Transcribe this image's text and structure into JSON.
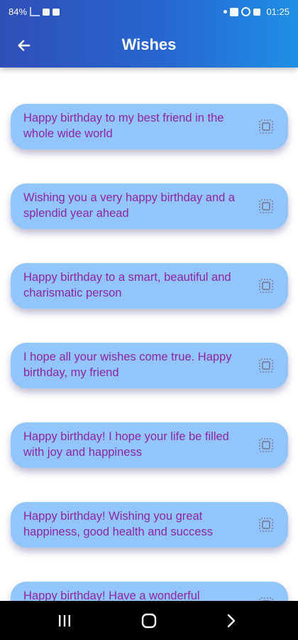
{
  "status_bar": {
    "battery": "84%",
    "time": "01:25"
  },
  "app_bar": {
    "title": "Wishes",
    "back_icon": "arrow-left-icon"
  },
  "wishes": [
    {
      "text": "Happy birthday to my best friend in the whole wide world"
    },
    {
      "text": "Wishing you a very happy birthday and a splendid year ahead"
    },
    {
      "text": "Happy birthday to a smart, beautiful and charismatic person"
    },
    {
      "text": "I hope all your wishes come true. Happy birthday, my friend"
    },
    {
      "text": "Happy birthday! I hope your life be filled with joy and happiness"
    },
    {
      "text": "Happy birthday! Wishing you great happiness, good health and success"
    },
    {
      "text": "Happy birthday! Have a wonderful"
    }
  ],
  "card_icon": "copy-icon",
  "colors": {
    "card_background": "#92c6fb",
    "card_text": "#8e24aa",
    "app_bar_start": "#2f4fb8",
    "app_bar_end": "#1f8fe6"
  },
  "nav_bar": {
    "icons": [
      "recents-icon",
      "home-icon",
      "back-chevron-icon"
    ]
  }
}
